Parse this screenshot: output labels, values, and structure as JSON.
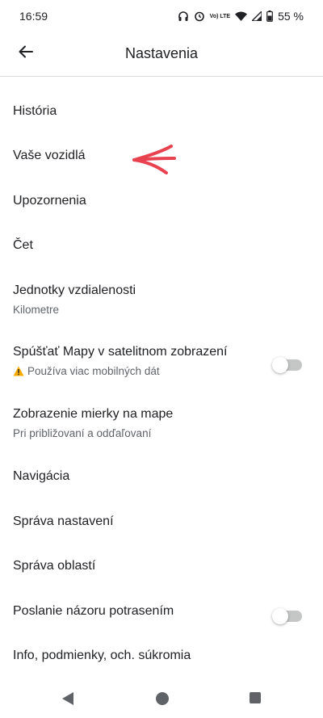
{
  "status_bar": {
    "time": "16:59",
    "network_label": "Vo) LTE",
    "battery": "55 %"
  },
  "app_bar": {
    "title": "Nastavenia",
    "back_icon": "arrow-back-icon"
  },
  "settings": {
    "items": [
      {
        "title": "História"
      },
      {
        "title": "Vaše vozidlá"
      },
      {
        "title": "Upozornenia"
      },
      {
        "title": "Čet"
      },
      {
        "title": "Jednotky vzdialenosti",
        "subtitle": "Kilometre"
      },
      {
        "title": "Spúšťať Mapy v satelitnom zobrazení",
        "subtitle": "Používa viac mobilných dát",
        "toggle": false,
        "subtitle_icon": "warning-icon"
      },
      {
        "title": "Zobrazenie mierky na mape",
        "subtitle": "Pri približovaní a odďaľovaní"
      },
      {
        "title": "Navigácia"
      },
      {
        "title": "Správa nastavení"
      },
      {
        "title": "Správa oblastí"
      },
      {
        "title": "Poslanie názoru potrasením",
        "toggle": false
      },
      {
        "title": "Info, podmienky, och. súkromia"
      }
    ]
  },
  "colors": {
    "annotation_arrow": "#e8414f",
    "toggle_off_track": "#c4c7c5",
    "secondary_text": "#5f6368"
  },
  "nav_bar": {
    "icons": [
      "back-triangle-icon",
      "home-circle-icon",
      "recents-square-icon"
    ]
  }
}
